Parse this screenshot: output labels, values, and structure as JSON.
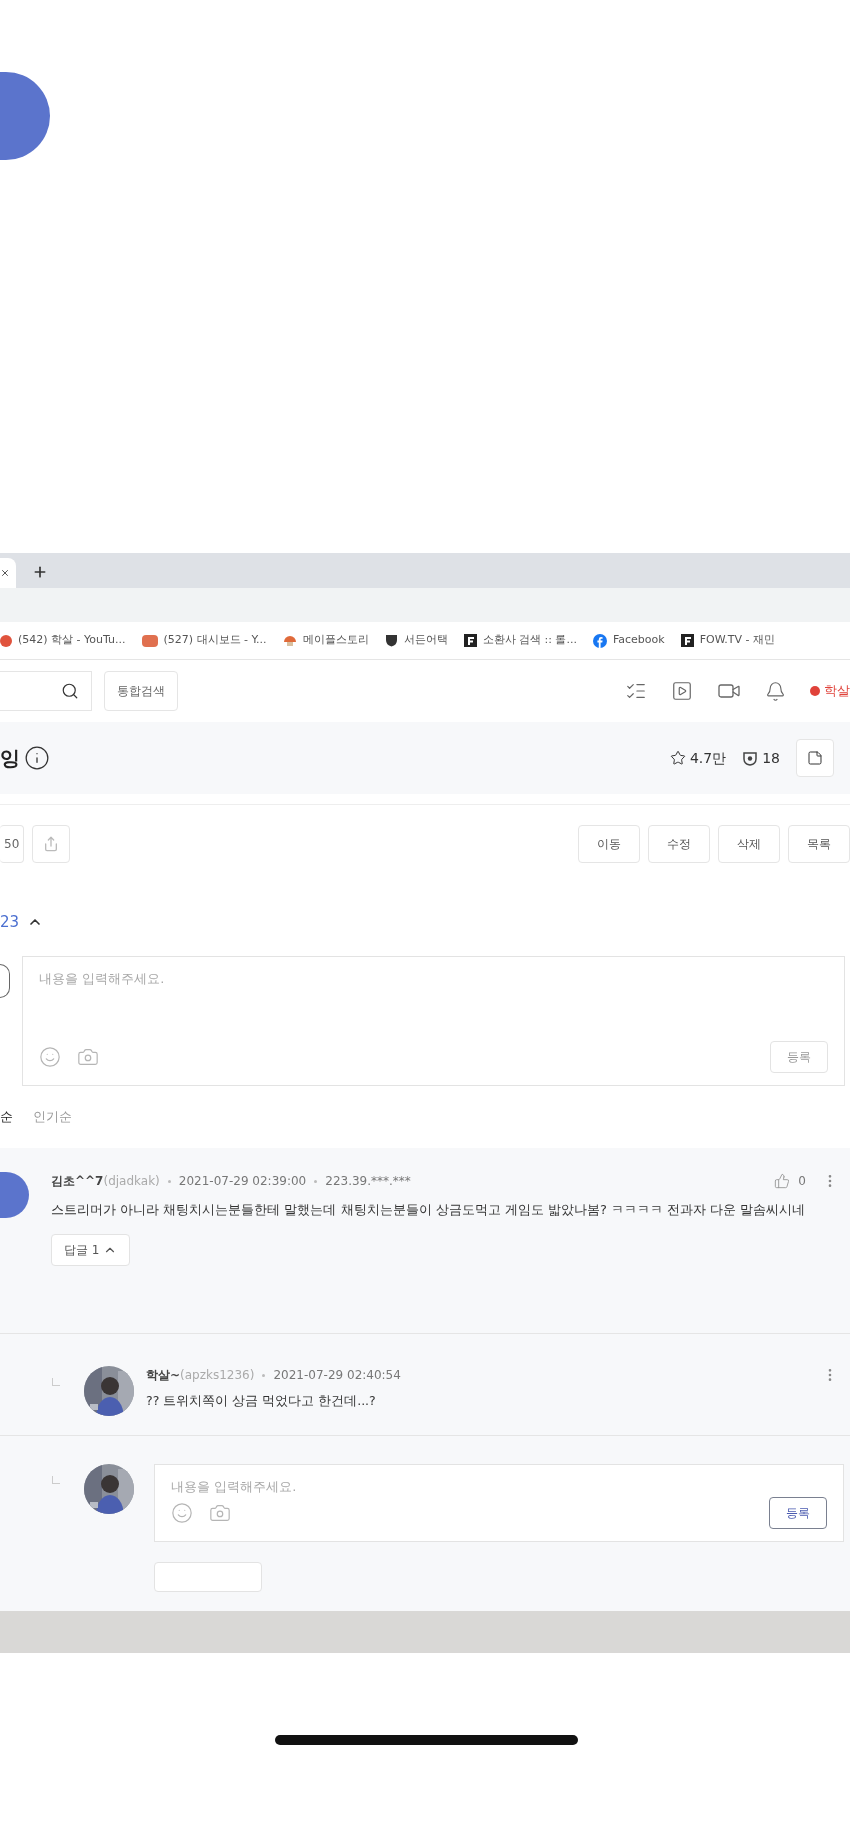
{
  "bookmarks": [
    {
      "label": "(542) 학살 - YouTu...",
      "kind": "youtube"
    },
    {
      "label": "(527) 대시보드 - Y...",
      "kind": "studio"
    },
    {
      "label": "메이플스토리",
      "kind": "mushroom"
    },
    {
      "label": "서든어택",
      "kind": "shield"
    },
    {
      "label": "소환사 검색 :: 롤...",
      "kind": "f"
    },
    {
      "label": "Facebook",
      "kind": "facebook"
    },
    {
      "label": "FOW.TV - 재민",
      "kind": "f"
    }
  ],
  "header": {
    "search_button": "통합검색",
    "user": "학살"
  },
  "board": {
    "title": "잉",
    "favorites": "4.7만",
    "subscribers": "18"
  },
  "actions": {
    "count": "50",
    "buttons": [
      "이동",
      "수정",
      "삭제",
      "목록"
    ]
  },
  "comments_count": "23",
  "comment_input": {
    "placeholder": "내용을 입력해주세요.",
    "submit": "등록"
  },
  "sort": [
    {
      "label": "순",
      "selected": true
    },
    {
      "label": "인기순",
      "selected": false
    }
  ],
  "comment": {
    "author": "김초^^7",
    "user_id": "(djadkak)",
    "date": "2021-07-29 02:39:00",
    "ip": "223.39.***.***",
    "likes": "0",
    "text": "스트리머가 아니라 채팅치시는분들한테 말했는데 채팅치는분들이 상금도먹고 게임도 밟았나봄? ㅋㅋㅋㅋ 전과자 다운 말솜씨시네",
    "replies_button": "답글 1"
  },
  "reply": {
    "author": "학살~",
    "user_id": "(apzks1236)",
    "date": "2021-07-29 02:40:54",
    "text": "?? 트위치쪽이 상금 먹었다고 한건데...?"
  },
  "reply_input": {
    "placeholder": "내용을 입력해주세요.",
    "submit": "등록"
  }
}
